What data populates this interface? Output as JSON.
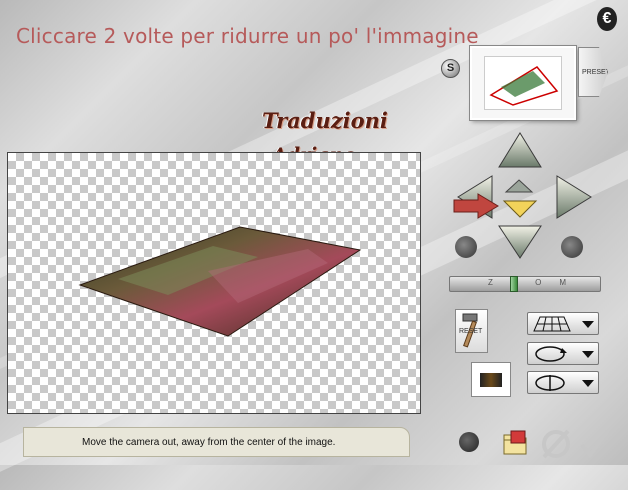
{
  "header": {
    "instruction": "Cliccare 2 volte per ridurre un po' l'immagine"
  },
  "watermark": {
    "line1": "Traduzioni",
    "line2": "Adriano"
  },
  "preview": {
    "s_label": "S",
    "presets_label": "PRESETS"
  },
  "controls": {
    "zoom_label": "ZOOM",
    "zoom_level": 0.42,
    "reset_label": "RESET"
  },
  "status": {
    "text": "Move the camera out, away from the center of the image."
  },
  "colors": {
    "instruction": "#b65a5a",
    "pointer_arrow": "#c0463f",
    "active_arrow": "#f2d35a"
  },
  "icons": [
    "logo-icon",
    "arrow-up-icon",
    "arrow-down-icon",
    "arrow-left-icon",
    "arrow-right-icon",
    "rotate-left-icon",
    "rotate-right-icon",
    "grid-icon",
    "folder-icon",
    "cancel-icon",
    "ok-icon",
    "hammer-icon"
  ]
}
